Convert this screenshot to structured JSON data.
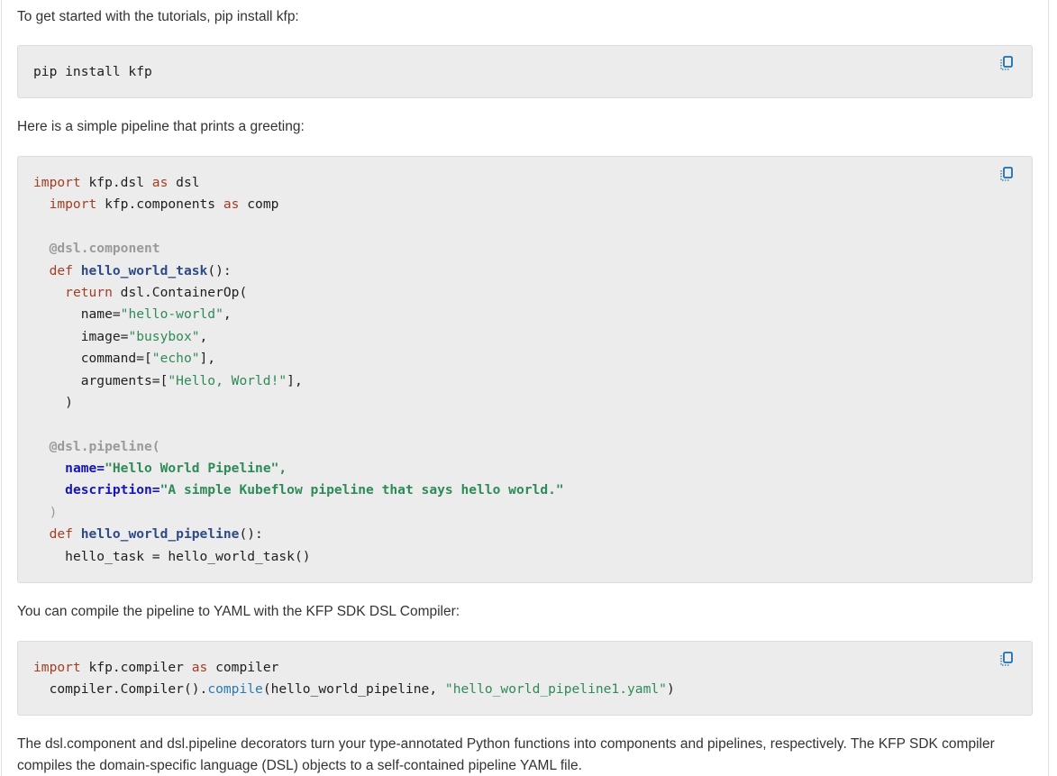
{
  "intro_text": "To get started with the tutorials, pip install kfp:",
  "install_code": {
    "lines": [
      "pip install kfp"
    ]
  },
  "pipeline_intro": "Here is a simple pipeline that prints a greeting:",
  "pipeline_code": {
    "l1": {
      "kw": "import",
      "rest": " kfp.dsl ",
      "kw2": "as",
      "rest2": " dsl"
    },
    "l2": {
      "kw": "import",
      "rest": " kfp.components ",
      "kw2": "as",
      "rest2": " comp"
    },
    "l4": {
      "dec": "@dsl.component"
    },
    "l5": {
      "kw": "def",
      "fn": "hello_world_task",
      "rest": "():"
    },
    "l6": {
      "kw": "return",
      "rest": " dsl.ContainerOp("
    },
    "l7": {
      "pre": "name=",
      "str": "\"hello-world\"",
      "post": ","
    },
    "l8": {
      "pre": "image=",
      "str": "\"busybox\"",
      "post": ","
    },
    "l9": {
      "pre": "command=[",
      "str": "\"echo\"",
      "post": "],"
    },
    "l10": {
      "pre": "arguments=[",
      "str": "\"Hello, World!\"",
      "post": "],"
    },
    "l11": {
      "text": ")"
    },
    "l13": {
      "dec": "@dsl.pipeline("
    },
    "l14": {
      "nm": "name=",
      "str": "\"Hello World Pipeline\"",
      "post": ","
    },
    "l15": {
      "nm": "description=",
      "str": "\"A simple Kubeflow pipeline that says hello world.\""
    },
    "l16": {
      "dec": ")"
    },
    "l17": {
      "kw": "def",
      "fn": "hello_world_pipeline",
      "rest": "():"
    },
    "l18": {
      "text": "hello_task = hello_world_task()"
    }
  },
  "compile_intro": "You can compile the pipeline to YAML with the KFP SDK DSL Compiler:",
  "compile_code": {
    "l1": {
      "kw": "import",
      "rest": " kfp.compiler ",
      "kw2": "as",
      "rest2": " compiler"
    },
    "l2": {
      "pre": "compiler.Compiler().",
      "call": "compile",
      "mid": "(hello_world_pipeline, ",
      "str": "\"hello_world_pipeline1.yaml\"",
      "post": ")"
    }
  },
  "outro_text": "The dsl.component and dsl.pipeline decorators turn your type-annotated Python functions into components and pipelines, respectively. The KFP SDK compiler compiles the domain-specific language (DSL) objects to a self-contained pipeline YAML file.",
  "copy_icon": "copy-icon",
  "colors": {
    "code_bg": "#ececec",
    "keyword": "#a33e24",
    "string": "#2e8b57",
    "function": "#2e4a87",
    "copy_icon": "#1a6fb5"
  }
}
